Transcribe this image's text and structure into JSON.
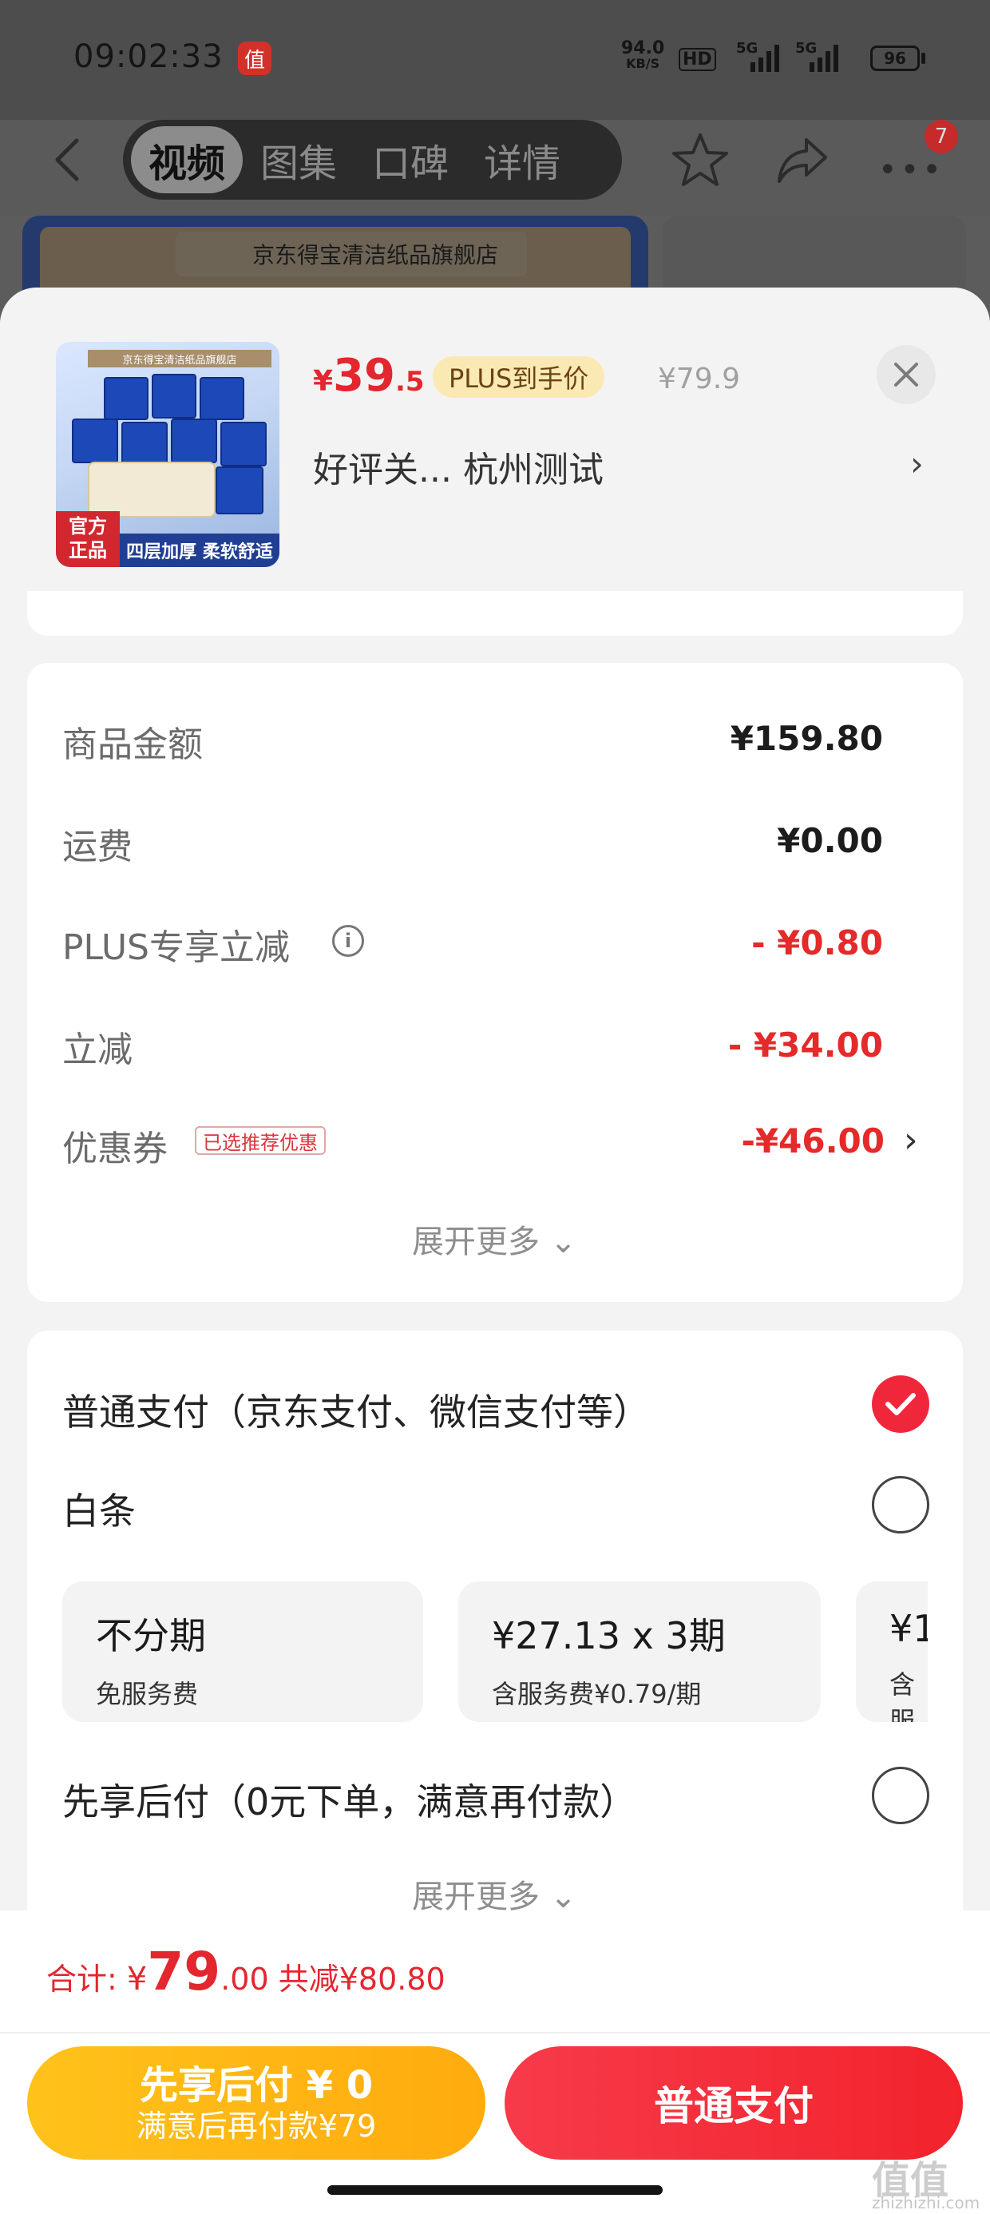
{
  "status_bar": {
    "time": "09:02:33",
    "app_icon_glyph": "值",
    "net_speed_value": "94.0",
    "net_speed_unit": "KB/S",
    "hd_label": "HD",
    "sig1_label": "5G",
    "sig2_label": "5G",
    "battery": "96"
  },
  "nav": {
    "tabs": [
      {
        "label": "视频",
        "active": true
      },
      {
        "label": "图集",
        "active": false
      },
      {
        "label": "口碑",
        "active": false
      },
      {
        "label": "详情",
        "active": false
      }
    ],
    "more_badge": "7"
  },
  "background": {
    "store_name": "京东得宝清洁纸品旗舰店"
  },
  "product": {
    "thumb_store": "京东得宝清洁纸品旗舰店",
    "badge_official": "官方正品",
    "badge_official_l1": "官方",
    "badge_official_l2": "正品",
    "badge_feature": "四层加厚 柔软舒适",
    "price_symbol": "¥",
    "price_int": "39",
    "price_dec": ".5",
    "plus_tag": "PLUS到手价",
    "original_price": "¥79.9",
    "spec": "好评关...  杭州测试",
    "spec_chevron": "›"
  },
  "summary": {
    "rows": [
      {
        "label": "商品金额",
        "value": "¥159.80"
      },
      {
        "label": "运费",
        "value": "¥0.00"
      },
      {
        "label": "PLUS专享立减",
        "value": "- ¥0.80"
      },
      {
        "label": "立减",
        "value": "- ¥34.00"
      },
      {
        "label": "优惠券",
        "value": "-¥46.00"
      }
    ],
    "info_icon": "i",
    "coupon_tag": "已选推荐优惠",
    "expand": "展开更多 ⌄"
  },
  "payment": {
    "options": [
      {
        "label": "普通支付（京东支付、微信支付等）",
        "selected": true
      },
      {
        "label": "白条",
        "selected": false
      },
      {
        "label": "先享后付（0元下单，满意再付款）",
        "selected": false
      }
    ],
    "installments": [
      {
        "title": "不分期",
        "sub": "免服务费"
      },
      {
        "title": "¥27.13 x 3期",
        "sub": "含服务费¥0.79/期"
      },
      {
        "title": "¥1",
        "sub": "含服"
      }
    ],
    "expand": "展开更多 ⌄"
  },
  "footer": {
    "total_label": "合计: ",
    "total_currency": "¥",
    "total_int": "79",
    "total_dec": ".00",
    "discount": " 共减¥80.80",
    "btn_later_line1": "先享后付 ¥ 0",
    "btn_later_line2": "满意后再付款¥79",
    "btn_pay": "普通支付"
  },
  "watermark": {
    "mark": "值值值",
    "site": "zhizhizhi.com"
  },
  "colors": {
    "accent_red": "#e4262f",
    "pay_button": "#f2232c",
    "later_button": "#ffb813",
    "plus_tag_bg": "#fbe9b4"
  }
}
